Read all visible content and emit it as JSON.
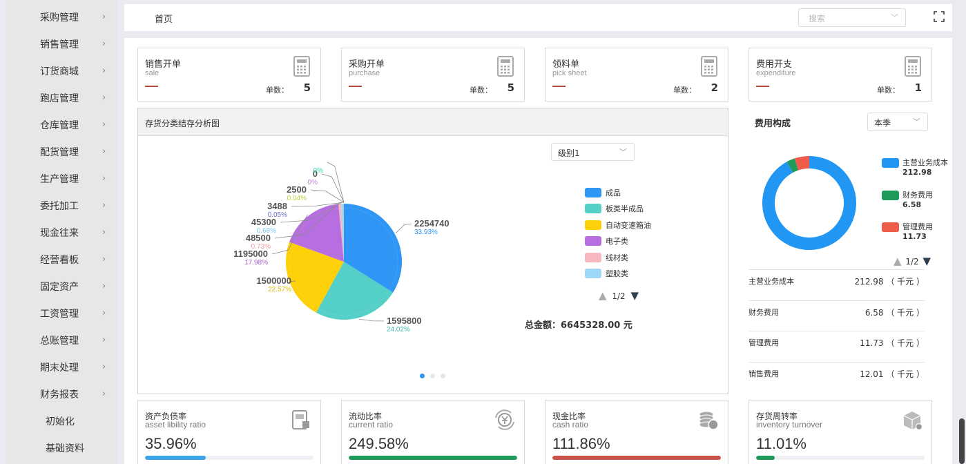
{
  "sidebar": {
    "items": [
      {
        "label": "采购管理",
        "chevron": true
      },
      {
        "label": "销售管理",
        "chevron": true
      },
      {
        "label": "订货商城",
        "chevron": true
      },
      {
        "label": "跑店管理",
        "chevron": true
      },
      {
        "label": "仓库管理",
        "chevron": true
      },
      {
        "label": "配货管理",
        "chevron": true
      },
      {
        "label": "生产管理",
        "chevron": true
      },
      {
        "label": "委托加工",
        "chevron": true
      },
      {
        "label": "现金往来",
        "chevron": true
      },
      {
        "label": "经营看板",
        "chevron": true
      },
      {
        "label": "固定资产",
        "chevron": true
      },
      {
        "label": "工资管理",
        "chevron": true
      },
      {
        "label": "总账管理",
        "chevron": true
      },
      {
        "label": "期末处理",
        "chevron": true
      },
      {
        "label": "财务报表",
        "chevron": true
      },
      {
        "label": "初始化",
        "chevron": false
      },
      {
        "label": "基础资料",
        "chevron": false
      }
    ],
    "chevron_glyph": "›"
  },
  "topbar": {
    "breadcrumb": "首页",
    "search_placeholder": "搜索",
    "fullscreen_icon": "fullscreen-icon"
  },
  "kpis": [
    {
      "title": "销售开单",
      "sub": "sale",
      "count_label": "单数：",
      "count": "5",
      "icon": "calculator-icon"
    },
    {
      "title": "采购开单",
      "sub": "purchase",
      "count_label": "单数：",
      "count": "5",
      "icon": "calculator-icon"
    },
    {
      "title": "领料单",
      "sub": "pick sheet",
      "count_label": "单数：",
      "count": "2",
      "icon": "calculator-icon"
    },
    {
      "title": "费用开支",
      "sub": "expenditure",
      "count_label": "单数：",
      "count": "1",
      "icon": "calculator-icon"
    }
  ],
  "inventory_panel": {
    "title": "存货分类结存分析图",
    "level_select": "级别1",
    "legend": [
      {
        "label": "成品",
        "color": "#2f96f5"
      },
      {
        "label": "板类半成品",
        "color": "#55d0c8"
      },
      {
        "label": "自动变速箱油",
        "color": "#fdd00a"
      },
      {
        "label": "电子类",
        "color": "#b66ee0"
      },
      {
        "label": "线材类",
        "color": "#f6b7be"
      },
      {
        "label": "塑胶类",
        "color": "#9fd8f7"
      }
    ],
    "legend_page": "1/2",
    "total": "总金额：6645328.00 元",
    "pie_labels": [
      {
        "value": "2254740",
        "pct": "33.93%",
        "pct_color": "#2f96f5"
      },
      {
        "value": "1595800",
        "pct": "24.02%",
        "pct_color": "#3bb8b0"
      },
      {
        "value": "1500000",
        "pct": "22.57%",
        "pct_color": "#e0b800"
      },
      {
        "value": "1195000",
        "pct": "17.98%",
        "pct_color": "#a35fcc"
      },
      {
        "value": "48500",
        "pct": "0.73%",
        "pct_color": "#f29aa6"
      },
      {
        "value": "45300",
        "pct": "0.68%",
        "pct_color": "#7ec8f0"
      },
      {
        "value": "3488",
        "pct": "0.05%",
        "pct_color": "#6a6fc7"
      },
      {
        "value": "2500",
        "pct": "0.04%",
        "pct_color": "#b8d038"
      },
      {
        "value": "0",
        "pct": "0%",
        "pct_color": "#c07ad8"
      },
      {
        "value": "",
        "pct": "0%",
        "pct_color": "#39d5b8"
      }
    ]
  },
  "chart_data": {
    "type": "pie",
    "title": "存货分类结存分析图",
    "categories": [
      "成品",
      "板类半成品",
      "自动变速箱油",
      "电子类",
      "线材类",
      "塑胶类",
      "",
      "",
      "",
      ""
    ],
    "values": [
      2254740,
      1595800,
      1500000,
      1195000,
      48500,
      45300,
      3488,
      2500,
      0,
      0
    ],
    "colors": [
      "#2f96f5",
      "#55d0c8",
      "#fdd00a",
      "#b66ee0",
      "#f6b7be",
      "#9fd8f7",
      "#6a6fc7",
      "#b8d038",
      "#c07ad8",
      "#39d5b8"
    ],
    "legend_position": "right"
  },
  "expense": {
    "title": "费用构成",
    "period_select": "本季",
    "legend": [
      {
        "label": "主营业务成本",
        "value": "212.98",
        "color": "#2196f3"
      },
      {
        "label": "财务费用",
        "value": "6.58",
        "color": "#1e9a5a"
      },
      {
        "label": "管理费用",
        "value": "11.73",
        "color": "#ef5b4b"
      }
    ],
    "legend_page": "1/2",
    "rows": [
      {
        "label": "主营业务成本",
        "value": "212.98 （ 千元 ）"
      },
      {
        "label": "财务费用",
        "value": "6.58 （ 千元 ）"
      },
      {
        "label": "管理费用",
        "value": "11.73 （ 千元 ）"
      },
      {
        "label": "销售费用",
        "value": "12.01 （ 千元 ）"
      }
    ],
    "donut": {
      "values": [
        212.98,
        6.58,
        11.73
      ],
      "colors": [
        "#2196f3",
        "#1e9a5a",
        "#ef5b4b"
      ]
    }
  },
  "ratios": [
    {
      "title": "资产负债率",
      "sub": "asset libility ratio",
      "value": "35.96%",
      "fill": 0.36,
      "color": "#3ba4e8",
      "icon": "document-chart-icon"
    },
    {
      "title": "流动比率",
      "sub": "current ratio",
      "value": "249.58%",
      "fill": 1.0,
      "color": "#1e9a5a",
      "icon": "yen-cycle-icon"
    },
    {
      "title": "现金比率",
      "sub": "cash ratio",
      "value": "111.86%",
      "fill": 1.0,
      "color": "#c9524a",
      "icon": "coins-icon"
    },
    {
      "title": "存货周转率",
      "sub": "inventory turnover",
      "value": "11.01%",
      "fill": 0.11,
      "color": "#1e9a5a",
      "icon": "box-icon"
    }
  ]
}
